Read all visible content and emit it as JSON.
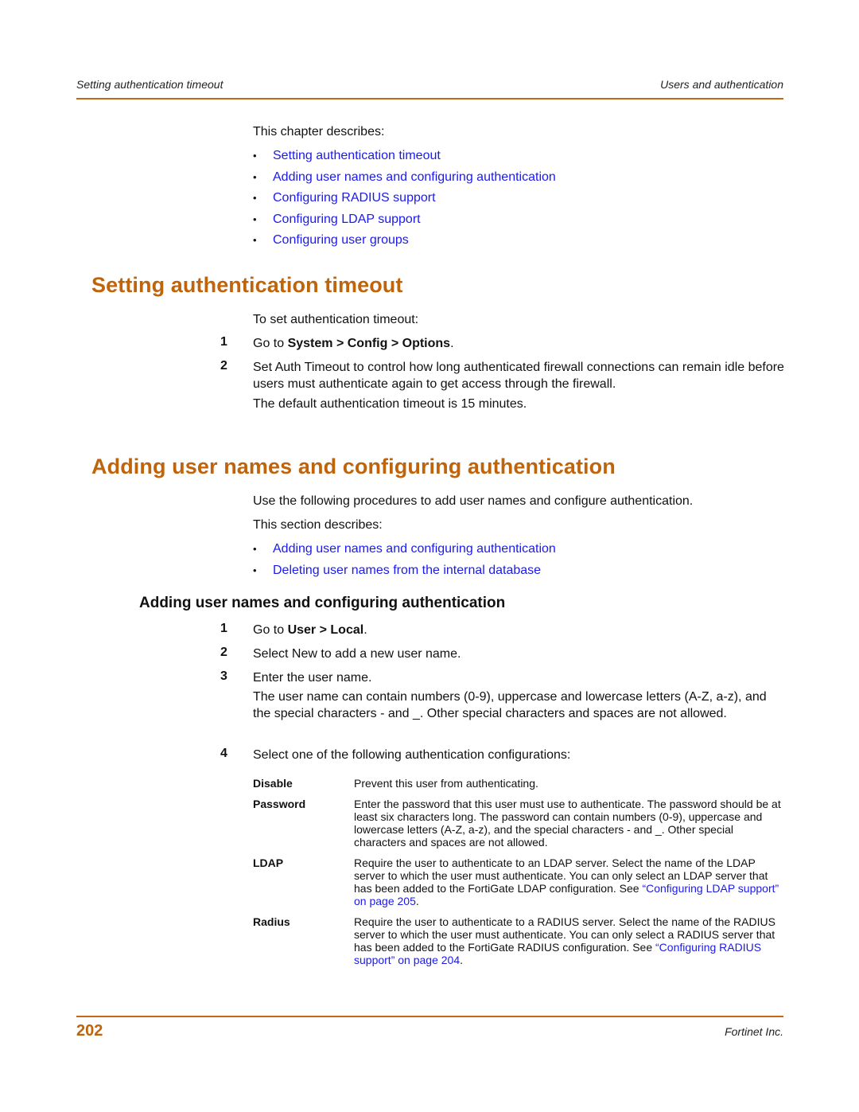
{
  "header": {
    "left": "Setting authentication timeout",
    "right": "Users and authentication"
  },
  "intro": {
    "lead": "This chapter describes:",
    "links": [
      "Setting authentication timeout",
      "Adding user names and configuring authentication",
      "Configuring RADIUS support",
      "Configuring LDAP support",
      "Configuring user groups"
    ]
  },
  "section1": {
    "title": "Setting authentication timeout",
    "lead": "To set authentication timeout:",
    "steps": [
      {
        "num": "1",
        "prefix": "Go to ",
        "bold": "System > Config > Options",
        "suffix": "."
      },
      {
        "num": "2",
        "text": "Set Auth Timeout to control how long authenticated firewall connections can remain idle before users must authenticate again to get access through the firewall.",
        "note": "The default authentication timeout is 15 minutes."
      }
    ]
  },
  "section2": {
    "title": "Adding user names and configuring authentication",
    "intro": "Use the following procedures to add user names and configure authentication.",
    "lead": "This section describes:",
    "links": [
      "Adding user names and configuring authentication",
      "Deleting user names from the internal database"
    ],
    "subsection": {
      "title": "Adding user names and configuring authentication",
      "steps": [
        {
          "num": "1",
          "prefix": "Go to ",
          "bold": "User > Local",
          "suffix": "."
        },
        {
          "num": "2",
          "text": "Select New to add a new user name."
        },
        {
          "num": "3",
          "text": "Enter the user name.",
          "note": "The user name can contain numbers (0-9), uppercase and lowercase letters (A-Z, a-z), and the special characters - and _. Other special characters and spaces are not allowed."
        },
        {
          "num": "4",
          "text": "Select one of the following authentication configurations:"
        }
      ],
      "options": [
        {
          "term": "Disable",
          "desc": "Prevent this user from authenticating."
        },
        {
          "term": "Password",
          "desc": "Enter the password that this user must use to authenticate. The password should be at least six characters long. The password can contain numbers (0-9), uppercase and lowercase letters (A-Z, a-z), and the special characters - and _. Other special characters and spaces are not allowed."
        },
        {
          "term": "LDAP",
          "desc": "Require the user to authenticate to an LDAP server. Select the name of the LDAP server to which the user must authenticate. You can only select an LDAP server that has been added to the FortiGate LDAP configuration. See ",
          "link": "“Configuring LDAP support” on page 205",
          "suffix": "."
        },
        {
          "term": "Radius",
          "desc": "Require the user to authenticate to a RADIUS server. Select the name of the RADIUS server to which the user must authenticate. You can only select a RADIUS server that has been added to the FortiGate RADIUS configuration. See ",
          "link": "“Configuring RADIUS support” on page 204",
          "suffix": "."
        }
      ]
    }
  },
  "footer": {
    "page_number": "202",
    "company": "Fortinet Inc."
  },
  "colors": {
    "accent": "#c0640b",
    "link": "#1a1aee",
    "text": "#111111"
  }
}
